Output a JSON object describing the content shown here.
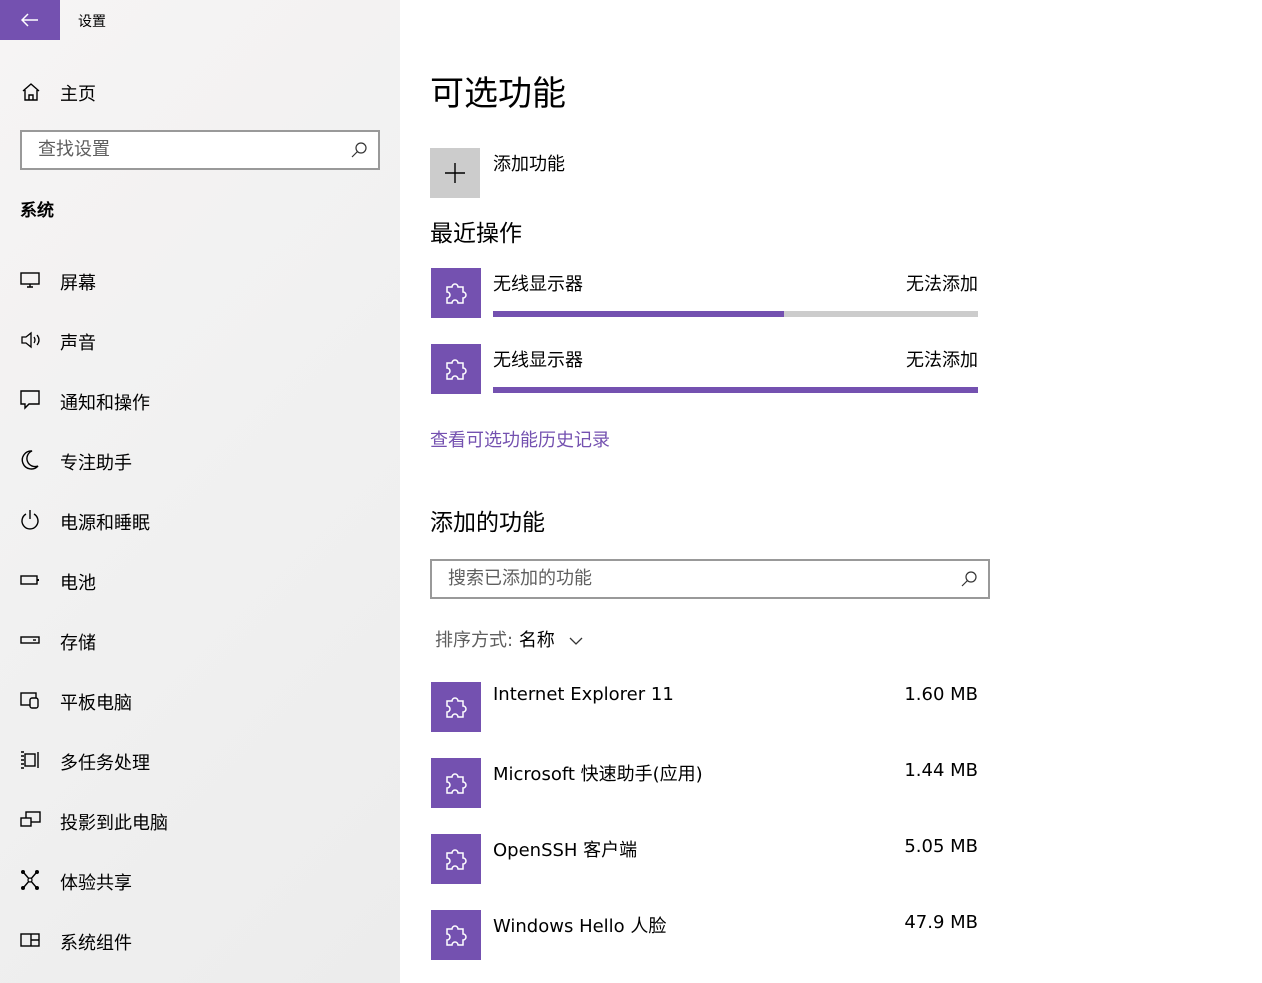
{
  "app": {
    "title": "设置"
  },
  "sidebar": {
    "home_label": "主页",
    "search_placeholder": "查找设置",
    "section_title": "系统",
    "items": [
      {
        "label": "屏幕",
        "icon": "monitor-icon"
      },
      {
        "label": "声音",
        "icon": "speaker-icon"
      },
      {
        "label": "通知和操作",
        "icon": "notification-icon"
      },
      {
        "label": "专注助手",
        "icon": "moon-icon"
      },
      {
        "label": "电源和睡眠",
        "icon": "power-icon"
      },
      {
        "label": "电池",
        "icon": "battery-icon"
      },
      {
        "label": "存储",
        "icon": "storage-icon"
      },
      {
        "label": "平板电脑",
        "icon": "tablet-icon"
      },
      {
        "label": "多任务处理",
        "icon": "multitask-icon"
      },
      {
        "label": "投影到此电脑",
        "icon": "project-icon"
      },
      {
        "label": "体验共享",
        "icon": "share-icon"
      },
      {
        "label": "系统组件",
        "icon": "components-icon"
      }
    ]
  },
  "main": {
    "title": "可选功能",
    "add_feature_label": "添加功能",
    "recent_title": "最近操作",
    "recent": [
      {
        "name": "无线显示器",
        "status": "无法添加",
        "progress": 0.6
      },
      {
        "name": "无线显示器",
        "status": "无法添加",
        "progress": 1.0
      }
    ],
    "history_link": "查看可选功能历史记录",
    "installed_title": "添加的功能",
    "installed_search_placeholder": "搜索已添加的功能",
    "sort_label": "排序方式:",
    "sort_value": "名称",
    "installed": [
      {
        "name": "Internet Explorer 11",
        "size": "1.60 MB"
      },
      {
        "name": "Microsoft 快速助手(应用)",
        "size": "1.44 MB"
      },
      {
        "name": "OpenSSH 客户端",
        "size": "5.05 MB"
      },
      {
        "name": "Windows Hello 人脸",
        "size": "47.9 MB"
      }
    ]
  },
  "colors": {
    "accent": "#7451b0",
    "track": "#cccccc",
    "sidebar_bg": "#f1f1f1"
  }
}
